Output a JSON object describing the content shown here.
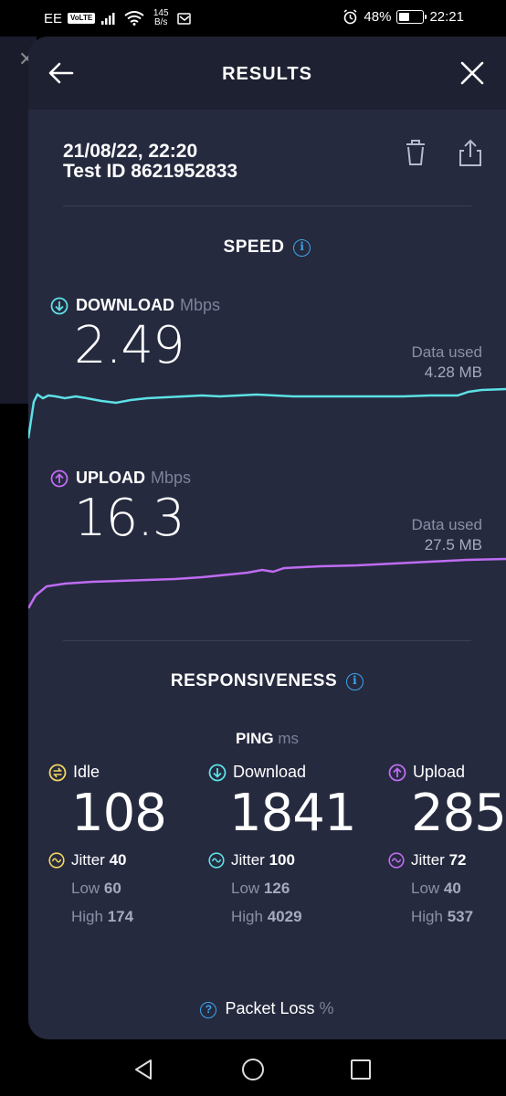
{
  "status_bar": {
    "carrier": "EE",
    "volte": "VoLTE",
    "net_speed_value": "145",
    "net_speed_unit": "B/s",
    "battery_pct": "48%",
    "battery_level": 0.48,
    "time": "22:21"
  },
  "header": {
    "title": "RESULTS"
  },
  "result": {
    "datetime": "21/08/22, 22:20",
    "test_id": "Test ID 8621952833"
  },
  "speed": {
    "title": "SPEED",
    "download": {
      "label": "DOWNLOAD",
      "unit": "Mbps",
      "value": "2.49",
      "data_used_label": "Data used",
      "data_used_value": "4.28 MB",
      "color": "#5ce1e6"
    },
    "upload": {
      "label": "UPLOAD",
      "unit": "Mbps",
      "value": "16.3",
      "data_used_label": "Data used",
      "data_used_value": "27.5 MB",
      "color": "#bf6cf2"
    }
  },
  "responsiveness": {
    "title": "RESPONSIVENESS",
    "ping_label": "PING",
    "ping_unit": "ms",
    "idle": {
      "label": "Idle",
      "value": "108",
      "jitter_label": "Jitter",
      "jitter": "40",
      "low_label": "Low",
      "low": "60",
      "high_label": "High",
      "high": "174",
      "color": "#f2d65f"
    },
    "download": {
      "label": "Download",
      "value": "1841",
      "jitter_label": "Jitter",
      "jitter": "100",
      "low_label": "Low",
      "low": "126",
      "high_label": "High",
      "high": "4029",
      "color": "#5ce1e6"
    },
    "upload": {
      "label": "Upload",
      "value": "285",
      "jitter_label": "Jitter",
      "jitter": "72",
      "low_label": "Low",
      "low": "40",
      "high_label": "High",
      "high": "537",
      "color": "#bf6cf2"
    }
  },
  "packet_loss": {
    "label": "Packet Loss",
    "unit": "%"
  }
}
